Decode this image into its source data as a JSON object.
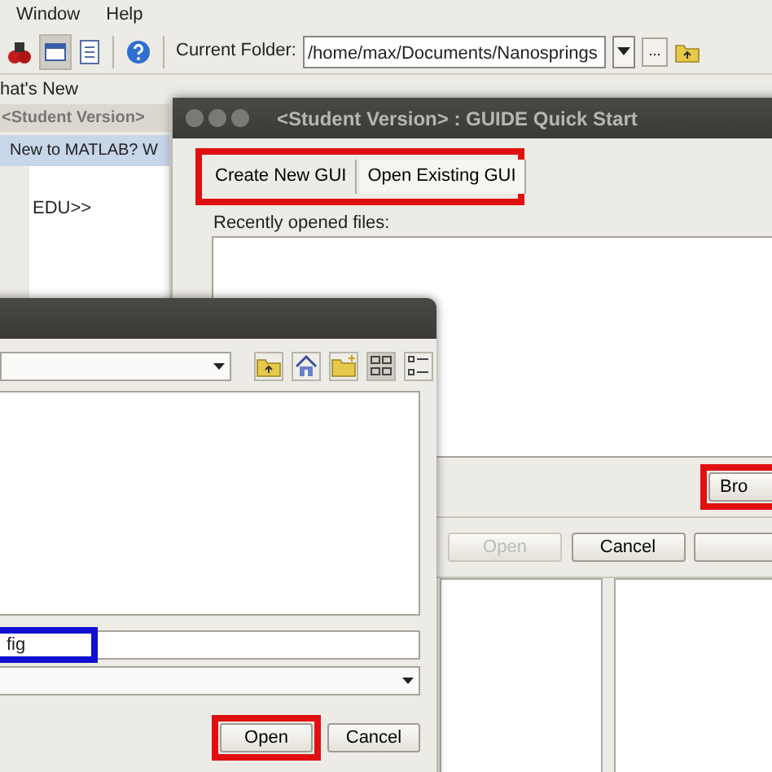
{
  "menu_bar": {
    "items": [
      "Window",
      "Help"
    ]
  },
  "toolbar": {
    "current_folder_label": "Current Folder:",
    "current_folder": "/home/max/Documents/Nanosprings",
    "browse_label": "..."
  },
  "shortcuts_bar": {
    "label": "hat's New"
  },
  "command_window": {
    "title": "<Student Version>",
    "banner": "New to MATLAB? W",
    "prompt": "EDU>>"
  },
  "guide_window": {
    "title": "<Student Version> : GUIDE Quick Start",
    "tabs": [
      {
        "label": "Create New GUI",
        "selected": false
      },
      {
        "label": "Open Existing GUI",
        "selected": true
      }
    ],
    "tabs_highlighted": true,
    "recent_label": "Recently opened files:",
    "browse_button": {
      "label": "Bro",
      "highlighted": true
    },
    "buttons": [
      {
        "label": "Open",
        "disabled": true
      },
      {
        "label": "Cancel",
        "disabled": false
      },
      {
        "disabled": false
      }
    ]
  },
  "file_dialog": {
    "view_buttons": [
      {
        "kind": "icons",
        "selected": true
      },
      {
        "kind": "list",
        "selected": false
      }
    ],
    "file_name": {
      "value": "fig",
      "highlighted": true
    },
    "buttons": [
      {
        "label": "Open",
        "highlighted": true
      },
      {
        "label": "Cancel",
        "highlighted": false
      }
    ]
  }
}
